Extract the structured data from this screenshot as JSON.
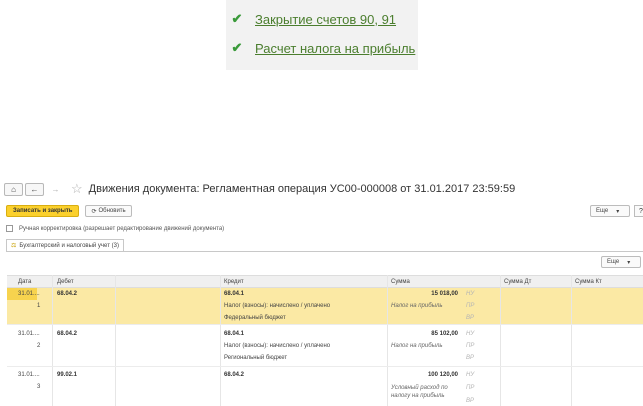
{
  "popup": {
    "items": [
      {
        "label": "Закрытие счетов 90, 91",
        "icon": "check-icon"
      },
      {
        "label": "Расчет налога на прибыль",
        "icon": "check-icon"
      }
    ]
  },
  "window": {
    "title": "Движения документа: Регламентная операция УС00-000008 от 31.01.2017 23:59:59"
  },
  "toolbar": {
    "save_close": "Записать и закрыть",
    "refresh": "Обновить",
    "more": "Еще",
    "help": "?"
  },
  "manual": {
    "label": "Ручная корректировка (разрешает редактирование движений документа)",
    "checked": false
  },
  "tab": {
    "label": "Бухгалтерский и налоговый учет (3)"
  },
  "table": {
    "more": "Еще",
    "headers": {
      "date": "Дата",
      "debit": "Дебет",
      "credit": "Кредит",
      "sum": "Сумма",
      "sum_dt": "Сумма Дт",
      "sum_kt": "Сумма Кт"
    },
    "rows": [
      {
        "date": "31.01....",
        "num": "1",
        "debit": "68.04.2",
        "credit": "68.04.1",
        "credit_sub1": "Налог (взносы): начислено / уплачено",
        "credit_sub2": "Федеральный бюджет",
        "sum": "15 018,00",
        "sum_note": "Налог на прибыль",
        "marks": [
          "НУ",
          "ПР",
          "ВР"
        ]
      },
      {
        "date": "31.01....",
        "num": "2",
        "debit": "68.04.2",
        "credit": "68.04.1",
        "credit_sub1": "Налог (взносы): начислено / уплачено",
        "credit_sub2": "Региональный бюджет",
        "sum": "85 102,00",
        "sum_note": "Налог на прибыль",
        "marks": [
          "НУ",
          "ПР",
          "ВР"
        ]
      },
      {
        "date": "31.01....",
        "num": "3",
        "debit": "99.02.1",
        "credit": "68.04.2",
        "credit_sub1": "",
        "credit_sub2": "",
        "sum": "100 120,00",
        "sum_note": "Условный расход по налогу на прибыль",
        "marks": [
          "НУ",
          "ПР",
          "ВР"
        ]
      }
    ]
  },
  "colors": {
    "accent": "#fbd02c",
    "highlight": "#fbe9a4",
    "link": "#4b7e2e"
  }
}
